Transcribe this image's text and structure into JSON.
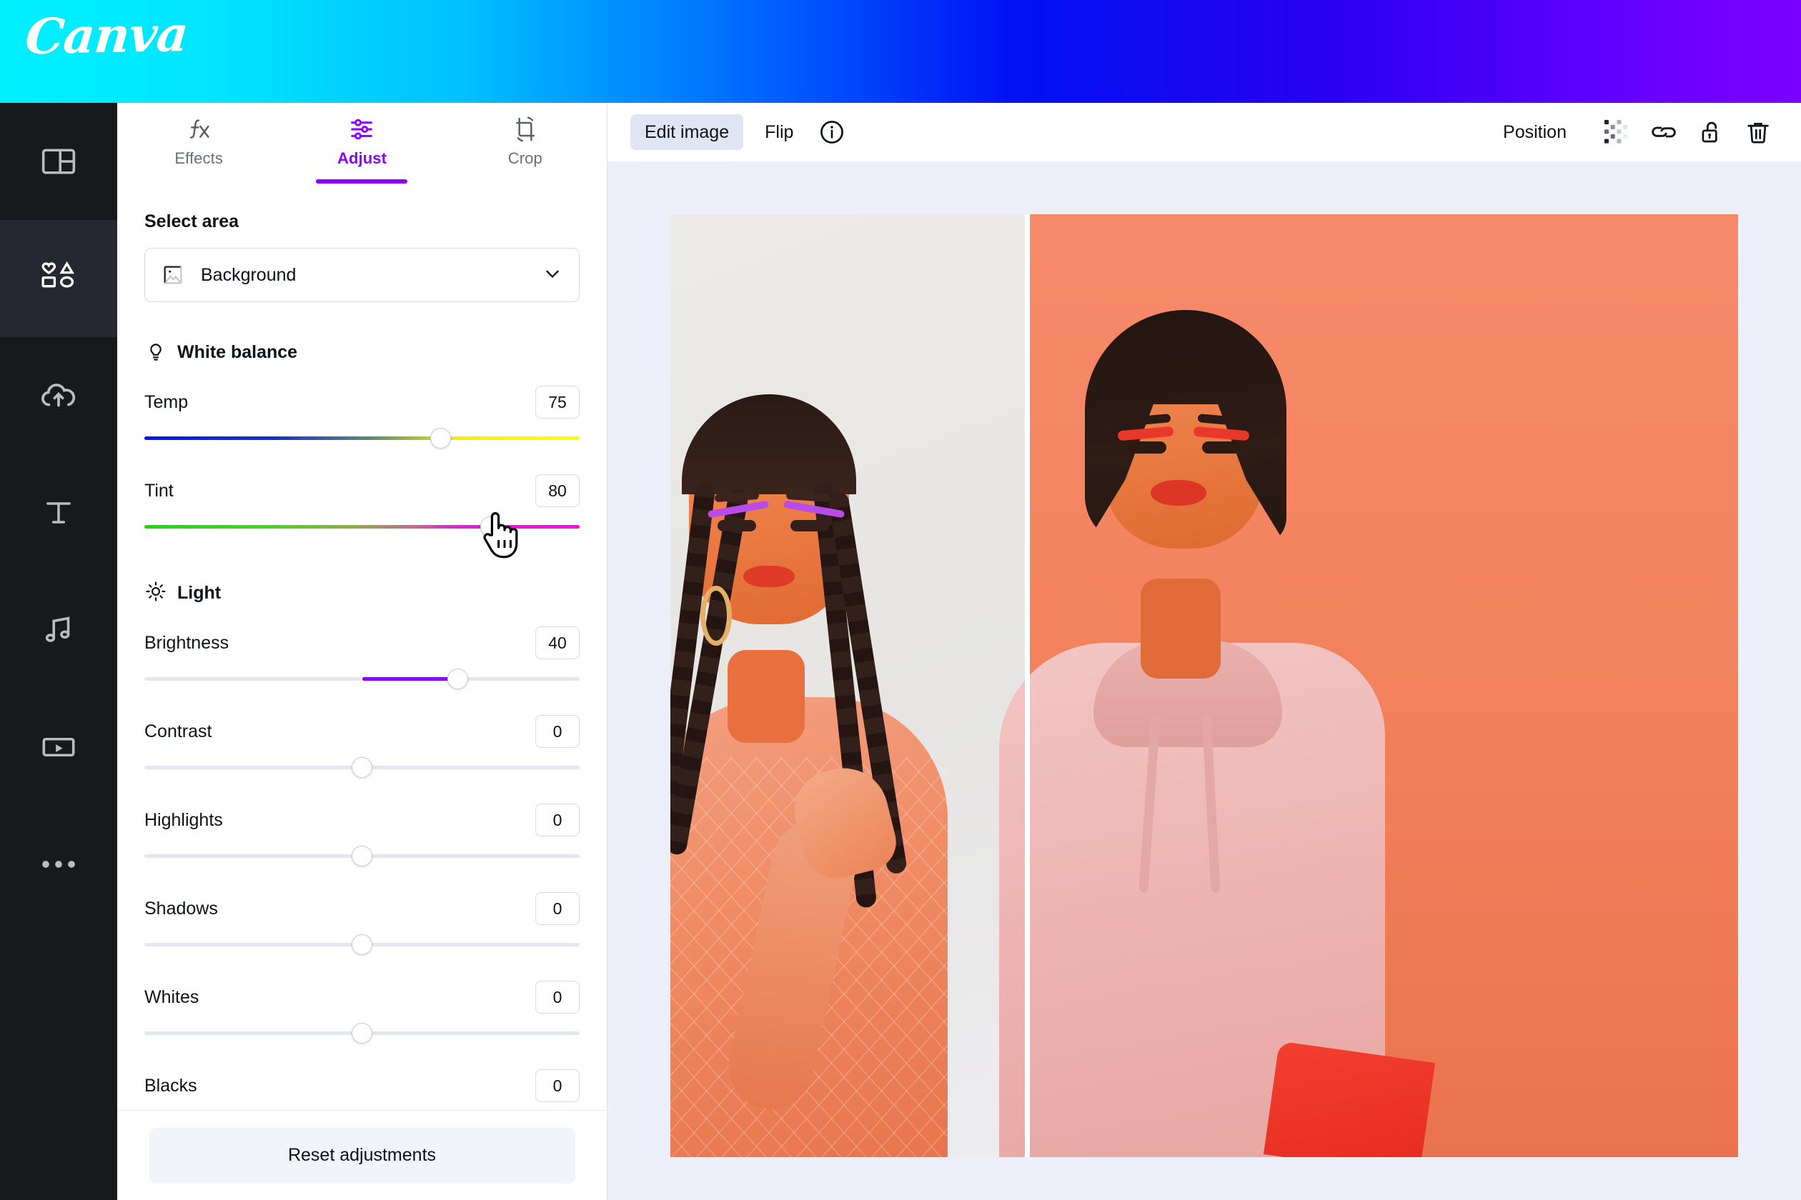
{
  "brand": {
    "logo_text": "Canva"
  },
  "colors": {
    "accent_purple": "#8b00ff",
    "gradient_start": "#00f0ff",
    "gradient_mid": "#0012f5",
    "gradient_end": "#7b00ff",
    "rail_bg": "#18191b",
    "stage_bg": "#eceffa",
    "edit_button_bg": "#dfe5f2",
    "reset_button_bg": "#f2f4fb"
  },
  "rail": {
    "items": [
      {
        "name": "design-templates",
        "icon": "layout-panel-icon",
        "active": false
      },
      {
        "name": "elements",
        "icon": "shapes-icon",
        "active": true
      },
      {
        "name": "uploads",
        "icon": "cloud-upload-icon",
        "active": false
      },
      {
        "name": "text",
        "icon": "text-t-icon",
        "active": false
      },
      {
        "name": "audio",
        "icon": "music-note-icon",
        "active": false
      },
      {
        "name": "videos",
        "icon": "video-play-icon",
        "active": false
      },
      {
        "name": "more",
        "icon": "ellipsis-icon",
        "active": false
      }
    ]
  },
  "panel": {
    "tabs": [
      {
        "label": "Effects",
        "icon": "fx-icon",
        "active": false
      },
      {
        "label": "Adjust",
        "icon": "sliders-icon",
        "active": true
      },
      {
        "label": "Crop",
        "icon": "crop-rotate-icon",
        "active": false
      }
    ],
    "select_area": {
      "title": "Select area",
      "selected": "Background",
      "icon": "image-placeholder-icon",
      "chevron": "chevron-down-icon"
    },
    "groups": [
      {
        "title": "White balance",
        "icon": "lightbulb-icon",
        "sliders": [
          {
            "label": "Temp",
            "value": "75",
            "pos": 68,
            "track": "grad-temp",
            "fill": false
          },
          {
            "label": "Tint",
            "value": "80",
            "pos": 72,
            "track": "grad-tint",
            "fill": false
          }
        ]
      },
      {
        "title": "Light",
        "icon": "sun-icon",
        "sliders": [
          {
            "label": "Brightness",
            "value": "40",
            "pos": 72,
            "track": "plain",
            "fill": true,
            "fill_from": 50
          },
          {
            "label": "Contrast",
            "value": "0",
            "pos": 50,
            "track": "plain",
            "fill": false
          },
          {
            "label": "Highlights",
            "value": "0",
            "pos": 50,
            "track": "plain",
            "fill": false
          },
          {
            "label": "Shadows",
            "value": "0",
            "pos": 50,
            "track": "plain",
            "fill": false
          },
          {
            "label": "Whites",
            "value": "0",
            "pos": 50,
            "track": "plain",
            "fill": false
          },
          {
            "label": "Blacks",
            "value": "0",
            "pos": 50,
            "track": "plain",
            "fill": false
          }
        ]
      }
    ],
    "reset_label": "Reset adjustments"
  },
  "toolbar": {
    "edit_image_label": "Edit image",
    "flip_label": "Flip",
    "info_icon": "info-circle-icon",
    "position_label": "Position",
    "right_icons": [
      {
        "name": "transparency-icon"
      },
      {
        "name": "link-icon"
      },
      {
        "name": "lock-open-icon"
      },
      {
        "name": "trash-icon"
      }
    ]
  },
  "canvas": {
    "image_description": "Two people posing against an orange backdrop, shown as a before/after split preview",
    "split_divider": "before-after-divider"
  },
  "cursor": {
    "type": "pointing-hand-cursor"
  }
}
